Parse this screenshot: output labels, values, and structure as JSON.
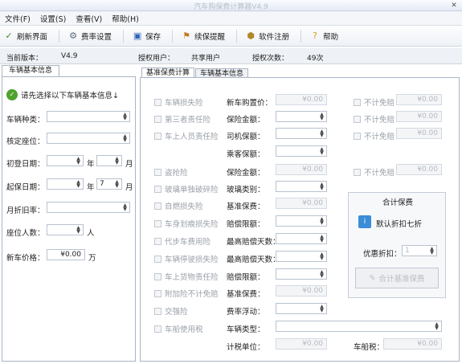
{
  "window": {
    "title": "汽车购保费计算器V4.9"
  },
  "menu": [
    "文件(F)",
    "设置(S)",
    "查看(V)",
    "帮助(H)"
  ],
  "toolbar": [
    {
      "label": "刷新界面",
      "icon": "✓"
    },
    {
      "label": "费率设置",
      "icon": "⚙"
    },
    {
      "label": "保存",
      "icon": "▣"
    },
    {
      "label": "续保提醒",
      "icon": "⚑"
    },
    {
      "label": "软件注册",
      "icon": "⬢"
    },
    {
      "label": "帮助",
      "icon": "?"
    }
  ],
  "info": {
    "version_label": "当前版本：",
    "version": "V4.9",
    "user_label": "授权用户：",
    "user": "共享用户",
    "count_label": "授权次数：",
    "count": "49次"
  },
  "left": {
    "tab": "车辆基本信息",
    "hint": "请先选择以下车辆基本信息↓",
    "car_type": "车辆种类：",
    "seats_rated": "核定座位：",
    "first_reg": "初登日期：",
    "insure_start": "起保日期：",
    "year_unit": "年",
    "month_unit": "月",
    "start_month": "7",
    "depreciation": "月折旧率：",
    "seat_count": "座位人数：",
    "person_unit": "人",
    "price_label": "新车价格：",
    "price": "¥0.00",
    "price_unit": "万"
  },
  "tabs": [
    "基准保费计算",
    "车辆基本信息"
  ],
  "checks": [
    "车辆损失险",
    "第三者责任险",
    "车上人员责任险",
    "盗抢险",
    "玻璃单独破碎险",
    "自燃损失险",
    "车身划痕损失险",
    "代步车费用险",
    "车辆停驶损失险",
    "车上货物责任险",
    "附加险不计免赔",
    "交强险",
    "车船使用税"
  ],
  "fields": {
    "purchase_price": "新车购置价：",
    "insured_amount": "保险金额：",
    "driver_insured": "司机保额：",
    "passenger_insured": "乘客保额：",
    "theft_amount": "保险金额：",
    "glass_type": "玻璃类别：",
    "base_premium": "基准保费：",
    "scratch_limit": "赔偿限额：",
    "max_days_1": "最高赔偿天数：",
    "max_days_2": "最高赔偿天数：",
    "cargo_limit": "赔偿限额：",
    "base_premium_2": "基准保费：",
    "rate_float": "费率浮动：",
    "vehicle_type": "车辆类型：",
    "unit": "计税单位：",
    "tax": "车船税："
  },
  "money_zero": "¥0.00",
  "exempt": "不计免赔",
  "totals": {
    "title": "合计保费",
    "default_discount": "默认折扣七折",
    "discount_label": "优惠折扣：",
    "discount_value": "1",
    "calc_button": "合计基准保费"
  }
}
